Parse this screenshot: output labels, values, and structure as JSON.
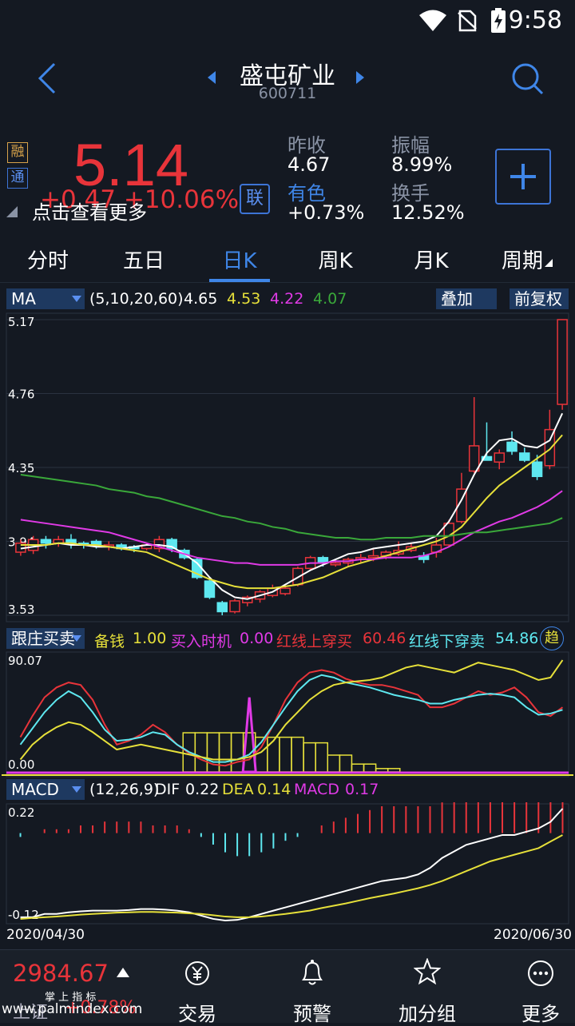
{
  "status": {
    "time": "9:58"
  },
  "nav": {
    "title": "盛屯矿业",
    "code": "600711"
  },
  "quote": {
    "price": "5.14",
    "change": "+0.47  +10.06%",
    "hint": "点击查看更多",
    "badge_rong": "融",
    "badge_tong": "通",
    "lian": "联",
    "prev_close_label": "昨收",
    "prev_close": "4.67",
    "amplitude_label": "振幅",
    "amplitude": "8.99%",
    "nonferrous_label": "有色",
    "nonferrous": "+0.73%",
    "turnover_label": "换手",
    "turnover": "12.52%"
  },
  "tabs": [
    "分时",
    "五日",
    "日K",
    "周K",
    "月K",
    "周期"
  ],
  "active_tab": "日K",
  "ma_legend": {
    "name": "MA",
    "params": "(5,10,20,60)",
    "v5": "4.65",
    "v10": "4.53",
    "v20": "4.22",
    "v60": "4.07",
    "overlay": "叠加",
    "adjust": "前复权"
  },
  "indicator_legend": {
    "name": "跟庄买卖",
    "l1": "备钱",
    "v1": "1.00",
    "l2": "买入时机",
    "v2": "0.00",
    "l3": "红线上穿买",
    "v3": "60.46",
    "l4": "红线下穿卖",
    "v4": "54.86",
    "more": "趋"
  },
  "macd_legend": {
    "name": "MACD",
    "params": "(12,26,9)",
    "dif_label": "DIF",
    "dif": "0.22",
    "dea_label": "DEA",
    "dea": "0.14",
    "macd_label": "MACD",
    "macd": "0.17"
  },
  "date_start": "2020/04/30",
  "date_end": "2020/06/30",
  "index": {
    "value": "2984.67",
    "name": "上证",
    "change": "+0.78%"
  },
  "bottom_tabs": [
    "交易",
    "预警",
    "加分组",
    "更多"
  ],
  "watermark": {
    "line1": "掌 上 指 标",
    "line2": "www.palmindex.com"
  },
  "colors": {
    "up": "#e8343a",
    "down": "#5ee8f0",
    "ma5": "#ffffff",
    "ma10": "#e6e03a",
    "ma20": "#e03ae6",
    "ma60": "#3aa83a",
    "accent": "#3f86e8"
  },
  "chart_data": [
    {
      "type": "candlestick",
      "title": "",
      "y_ticks": [
        "5.17",
        "4.76",
        "4.35",
        "3.94",
        "3.53"
      ],
      "ylim": [
        3.53,
        5.17
      ],
      "candles": [
        {
          "o": 3.88,
          "c": 3.93,
          "h": 3.95,
          "l": 3.86
        },
        {
          "o": 3.89,
          "c": 3.95,
          "h": 3.97,
          "l": 3.87
        },
        {
          "o": 3.95,
          "c": 3.93,
          "h": 3.97,
          "l": 3.9
        },
        {
          "o": 3.93,
          "c": 3.95,
          "h": 3.97,
          "l": 3.91
        },
        {
          "o": 3.95,
          "c": 3.93,
          "h": 3.98,
          "l": 3.9
        },
        {
          "o": 3.93,
          "c": 3.92,
          "h": 3.94,
          "l": 3.9
        },
        {
          "o": 3.94,
          "c": 3.92,
          "h": 3.95,
          "l": 3.9
        },
        {
          "o": 3.91,
          "c": 3.92,
          "h": 3.94,
          "l": 3.89
        },
        {
          "o": 3.92,
          "c": 3.9,
          "h": 3.93,
          "l": 3.89
        },
        {
          "o": 3.91,
          "c": 3.9,
          "h": 3.92,
          "l": 3.88
        },
        {
          "o": 3.9,
          "c": 3.92,
          "h": 3.93,
          "l": 3.89
        },
        {
          "o": 3.9,
          "c": 3.95,
          "h": 3.97,
          "l": 3.88
        },
        {
          "o": 3.95,
          "c": 3.9,
          "h": 3.96,
          "l": 3.88
        },
        {
          "o": 3.89,
          "c": 3.85,
          "h": 3.9,
          "l": 3.84
        },
        {
          "o": 3.84,
          "c": 3.74,
          "h": 3.85,
          "l": 3.73
        },
        {
          "o": 3.72,
          "c": 3.63,
          "h": 3.74,
          "l": 3.62
        },
        {
          "o": 3.6,
          "c": 3.55,
          "h": 3.61,
          "l": 3.53
        },
        {
          "o": 3.55,
          "c": 3.61,
          "h": 3.62,
          "l": 3.54
        },
        {
          "o": 3.6,
          "c": 3.63,
          "h": 3.64,
          "l": 3.58
        },
        {
          "o": 3.62,
          "c": 3.66,
          "h": 3.67,
          "l": 3.6
        },
        {
          "o": 3.64,
          "c": 3.68,
          "h": 3.7,
          "l": 3.63
        },
        {
          "o": 3.65,
          "c": 3.68,
          "h": 3.7,
          "l": 3.64
        },
        {
          "o": 3.7,
          "c": 3.79,
          "h": 3.8,
          "l": 3.69
        },
        {
          "o": 3.79,
          "c": 3.85,
          "h": 3.86,
          "l": 3.78
        },
        {
          "o": 3.85,
          "c": 3.82,
          "h": 3.86,
          "l": 3.8
        },
        {
          "o": 3.81,
          "c": 3.82,
          "h": 3.84,
          "l": 3.8
        },
        {
          "o": 3.82,
          "c": 3.84,
          "h": 3.85,
          "l": 3.8
        },
        {
          "o": 3.84,
          "c": 3.85,
          "h": 3.87,
          "l": 3.82
        },
        {
          "o": 3.85,
          "c": 3.86,
          "h": 3.9,
          "l": 3.83
        },
        {
          "o": 3.86,
          "c": 3.88,
          "h": 3.89,
          "l": 3.84
        },
        {
          "o": 3.87,
          "c": 3.89,
          "h": 3.94,
          "l": 3.86
        },
        {
          "o": 3.89,
          "c": 3.91,
          "h": 3.93,
          "l": 3.88
        },
        {
          "o": 3.86,
          "c": 3.84,
          "h": 3.88,
          "l": 3.82
        },
        {
          "o": 3.88,
          "c": 3.92,
          "h": 3.96,
          "l": 3.85
        },
        {
          "o": 3.92,
          "c": 4.04,
          "h": 4.06,
          "l": 3.91
        },
        {
          "o": 4.05,
          "c": 4.23,
          "h": 4.32,
          "l": 4.04
        },
        {
          "o": 4.33,
          "c": 4.47,
          "h": 4.74,
          "l": 4.32
        },
        {
          "o": 4.41,
          "c": 4.39,
          "h": 4.6,
          "l": 4.39
        },
        {
          "o": 4.38,
          "c": 4.43,
          "h": 4.45,
          "l": 4.34
        },
        {
          "o": 4.49,
          "c": 4.44,
          "h": 4.55,
          "l": 4.42
        },
        {
          "o": 4.43,
          "c": 4.39,
          "h": 4.46,
          "l": 4.38
        },
        {
          "o": 4.38,
          "c": 4.3,
          "h": 4.42,
          "l": 4.28
        },
        {
          "o": 4.36,
          "c": 4.56,
          "h": 4.67,
          "l": 4.34
        },
        {
          "o": 4.7,
          "c": 5.17,
          "h": 5.17,
          "l": 4.67
        }
      ],
      "series": [
        {
          "name": "MA5",
          "values": [
            3.9,
            3.91,
            3.92,
            3.93,
            3.92,
            3.92,
            3.91,
            3.91,
            3.9,
            3.91,
            3.92,
            3.92,
            3.91,
            3.87,
            3.82,
            3.74,
            3.67,
            3.63,
            3.62,
            3.64,
            3.66,
            3.7,
            3.74,
            3.78,
            3.81,
            3.84,
            3.87,
            3.88,
            3.9,
            3.91,
            3.92,
            3.93,
            3.94,
            3.97,
            4.05,
            4.17,
            4.31,
            4.43,
            4.5,
            4.51,
            4.47,
            4.46,
            4.5,
            4.65
          ]
        },
        {
          "name": "MA10",
          "values": [
            3.92,
            3.92,
            3.92,
            3.93,
            3.93,
            3.92,
            3.92,
            3.91,
            3.9,
            3.89,
            3.88,
            3.85,
            3.82,
            3.79,
            3.76,
            3.73,
            3.71,
            3.69,
            3.68,
            3.68,
            3.68,
            3.69,
            3.7,
            3.72,
            3.74,
            3.77,
            3.8,
            3.82,
            3.84,
            3.86,
            3.88,
            3.9,
            3.92,
            3.94,
            3.97,
            4.02,
            4.1,
            4.18,
            4.25,
            4.3,
            4.35,
            4.4,
            4.45,
            4.53
          ]
        },
        {
          "name": "MA20",
          "values": [
            4.06,
            4.05,
            4.04,
            4.03,
            4.02,
            4.01,
            4.0,
            3.99,
            3.97,
            3.95,
            3.93,
            3.91,
            3.89,
            3.87,
            3.85,
            3.84,
            3.83,
            3.82,
            3.82,
            3.81,
            3.81,
            3.81,
            3.81,
            3.82,
            3.82,
            3.83,
            3.83,
            3.84,
            3.84,
            3.85,
            3.85,
            3.85,
            3.86,
            3.88,
            3.91,
            3.95,
            3.99,
            4.02,
            4.05,
            4.07,
            4.1,
            4.13,
            4.17,
            4.22
          ]
        },
        {
          "name": "MA60",
          "values": [
            4.31,
            4.3,
            4.29,
            4.28,
            4.27,
            4.26,
            4.25,
            4.23,
            4.22,
            4.21,
            4.19,
            4.18,
            4.16,
            4.14,
            4.12,
            4.1,
            4.08,
            4.07,
            4.05,
            4.04,
            4.02,
            4.01,
            3.99,
            3.98,
            3.97,
            3.96,
            3.96,
            3.95,
            3.95,
            3.96,
            3.96,
            3.96,
            3.97,
            3.97,
            3.97,
            3.98,
            3.99,
            3.99,
            4.0,
            4.01,
            4.02,
            4.03,
            4.04,
            4.07
          ]
        }
      ]
    },
    {
      "type": "line",
      "title": "",
      "y_ticks": [
        "90.07",
        "0.00"
      ],
      "ylim": [
        0,
        90.07
      ],
      "series": [
        {
          "name": "红线",
          "values": [
            28,
            45,
            60,
            68,
            72,
            70,
            58,
            38,
            22,
            25,
            30,
            38,
            32,
            22,
            15,
            10,
            6,
            5,
            8,
            10,
            20,
            38,
            58,
            72,
            80,
            82,
            80,
            75,
            72,
            70,
            70,
            68,
            65,
            62,
            52,
            52,
            55,
            60,
            65,
            62,
            64,
            68,
            60,
            48,
            45,
            52
          ]
        },
        {
          "name": "蓝线",
          "values": [
            22,
            35,
            48,
            58,
            65,
            60,
            48,
            34,
            25,
            26,
            28,
            32,
            30,
            22,
            16,
            12,
            8,
            8,
            10,
            14,
            24,
            38,
            52,
            65,
            74,
            78,
            76,
            72,
            70,
            68,
            65,
            62,
            60,
            58,
            55,
            55,
            58,
            60,
            62,
            63,
            62,
            60,
            52,
            46,
            47,
            50
          ]
        },
        {
          "name": "黄线",
          "values": [
            10,
            22,
            30,
            36,
            40,
            38,
            32,
            25,
            18,
            20,
            22,
            20,
            18,
            16,
            14,
            12,
            10,
            10,
            10,
            12,
            16,
            25,
            38,
            48,
            58,
            65,
            70,
            72,
            73,
            74,
            76,
            80,
            84,
            86,
            84,
            82,
            80,
            84,
            88,
            86,
            84,
            82,
            78,
            74,
            76,
            90
          ]
        }
      ]
    },
    {
      "type": "bar+line",
      "title": "",
      "y_ticks": [
        "0.22",
        "-0.12"
      ],
      "ylim": [
        -0.12,
        0.22
      ],
      "bars": [
        -0.01,
        0.0,
        0.01,
        0.01,
        0.01,
        0.02,
        0.02,
        0.03,
        0.03,
        0.03,
        0.03,
        0.02,
        0.02,
        0.02,
        0.01,
        -0.01,
        -0.03,
        -0.05,
        -0.06,
        -0.06,
        -0.05,
        -0.04,
        -0.02,
        -0.01,
        0.0,
        0.02,
        0.03,
        0.04,
        0.05,
        0.06,
        0.07,
        0.07,
        0.07,
        0.07,
        0.07,
        0.08,
        0.09,
        0.1,
        0.11,
        0.11,
        0.11,
        0.1,
        0.1,
        0.1,
        0.12,
        0.17
      ],
      "series": [
        {
          "name": "DIF",
          "values": [
            -0.11,
            -0.11,
            -0.1,
            -0.1,
            -0.095,
            -0.092,
            -0.09,
            -0.09,
            -0.09,
            -0.088,
            -0.085,
            -0.085,
            -0.087,
            -0.09,
            -0.095,
            -0.105,
            -0.115,
            -0.12,
            -0.118,
            -0.11,
            -0.1,
            -0.09,
            -0.08,
            -0.07,
            -0.06,
            -0.05,
            -0.04,
            -0.03,
            -0.02,
            -0.01,
            0.0,
            0.005,
            0.01,
            0.02,
            0.04,
            0.07,
            0.09,
            0.11,
            0.12,
            0.13,
            0.14,
            0.14,
            0.15,
            0.16,
            0.18,
            0.22
          ]
        },
        {
          "name": "DEA",
          "values": [
            -0.115,
            -0.112,
            -0.11,
            -0.108,
            -0.105,
            -0.102,
            -0.1,
            -0.098,
            -0.096,
            -0.095,
            -0.094,
            -0.094,
            -0.095,
            -0.096,
            -0.098,
            -0.1,
            -0.104,
            -0.108,
            -0.11,
            -0.11,
            -0.108,
            -0.104,
            -0.1,
            -0.095,
            -0.09,
            -0.082,
            -0.075,
            -0.068,
            -0.06,
            -0.052,
            -0.045,
            -0.038,
            -0.03,
            -0.022,
            -0.012,
            0.0,
            0.015,
            0.03,
            0.045,
            0.06,
            0.07,
            0.08,
            0.09,
            0.1,
            0.12,
            0.14
          ]
        }
      ]
    }
  ]
}
